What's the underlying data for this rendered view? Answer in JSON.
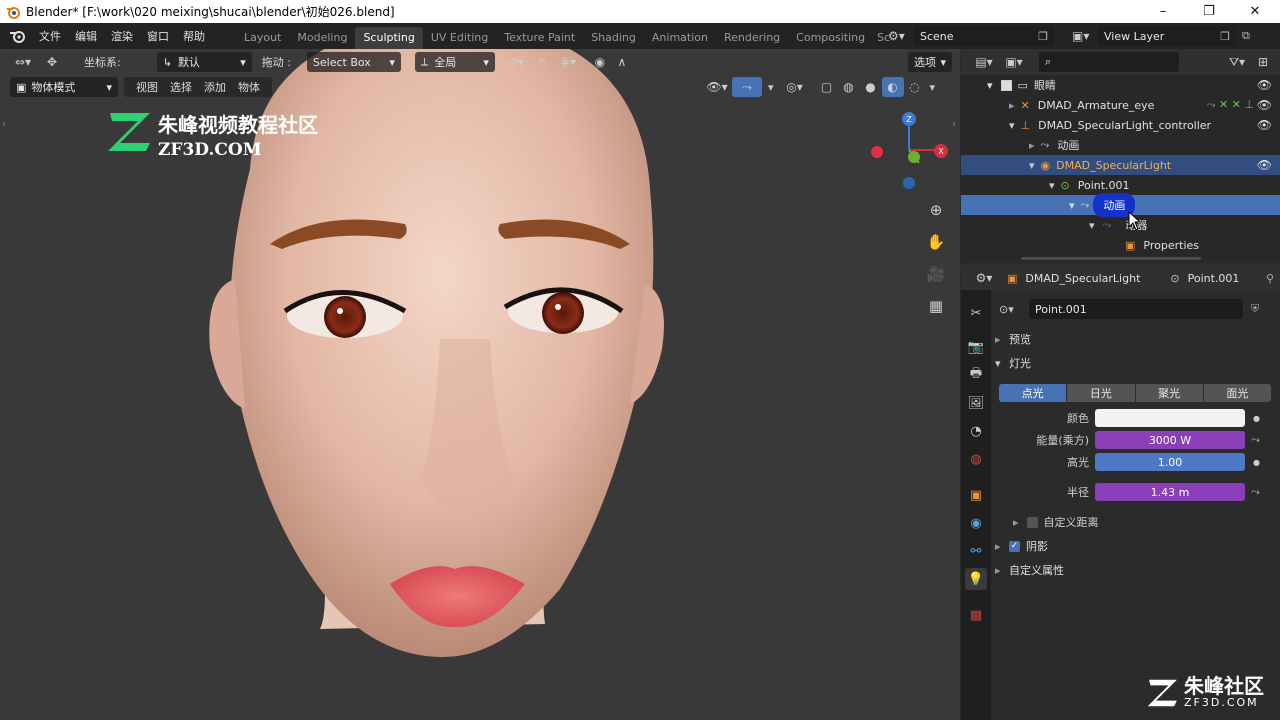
{
  "window": {
    "title": "Blender* [F:\\work\\020 meixing\\shucai\\blender\\初始026.blend]",
    "controls": [
      "–",
      "❐",
      "✕"
    ]
  },
  "menu": [
    "文件",
    "编辑",
    "渲染",
    "窗口",
    "帮助"
  ],
  "workspaces": [
    "Layout",
    "Modeling",
    "Sculpting",
    "UV Editing",
    "Texture Paint",
    "Shading",
    "Animation",
    "Rendering",
    "Compositing",
    "Sc"
  ],
  "active_workspace": "Sculpting",
  "scene": {
    "label": "Scene"
  },
  "view_layer": {
    "label": "View Layer"
  },
  "viewport_header": {
    "coord_label": "坐标系:",
    "coord_value": "默认",
    "drag_label": "拖动 :",
    "drag_value": "Select Box",
    "pivot_value": "全局",
    "options_label": "选项"
  },
  "viewport_header2": {
    "mode": "物体模式",
    "items": [
      "视图",
      "选择",
      "添加",
      "物体"
    ]
  },
  "watermark": {
    "text_cn": "朱峰视频教程社区",
    "text_en": "ZF3D.COM",
    "corner_cn": "朱峰社区",
    "corner_en": "ZF3D.COM"
  },
  "outliner": {
    "search_placeholder": "",
    "rows": [
      {
        "label": "眼睛",
        "indent": 0
      },
      {
        "label": "DMAD_Armature_eye",
        "indent": 1
      },
      {
        "label": "DMAD_SpecularLight_controller",
        "indent": 1
      },
      {
        "label": "动画",
        "indent": 2
      },
      {
        "label": "DMAD_SpecularLight",
        "indent": 2
      },
      {
        "label": "Point.001",
        "indent": 3
      },
      {
        "label": "动画",
        "indent": 4
      },
      {
        "label": "动器",
        "indent": 5
      },
      {
        "label": "Properties",
        "indent": 6
      }
    ]
  },
  "properties": {
    "object_name": "DMAD_SpecularLight",
    "data_name": "Point.001",
    "datablock": "Point.001",
    "panel_preview": "预览",
    "panel_light": "灯光",
    "light_types": [
      "点光",
      "日光",
      "聚光",
      "面光"
    ],
    "active_light_type": "点光",
    "fields": [
      {
        "label": "颜色",
        "value": ""
      },
      {
        "label": "能量(乘方)",
        "value": "3000 W"
      },
      {
        "label": "高光",
        "value": "1.00"
      },
      {
        "label": "半径",
        "value": "1.43 m"
      }
    ],
    "custom_distance": "自定义距离",
    "panel_shadow": "阴影",
    "panel_custom_props": "自定义属性",
    "colors": {
      "energy": "#8a3fb8",
      "specular": "#4f79c4",
      "radius": "#8a3fb8",
      "accent": "#4772b3"
    }
  }
}
